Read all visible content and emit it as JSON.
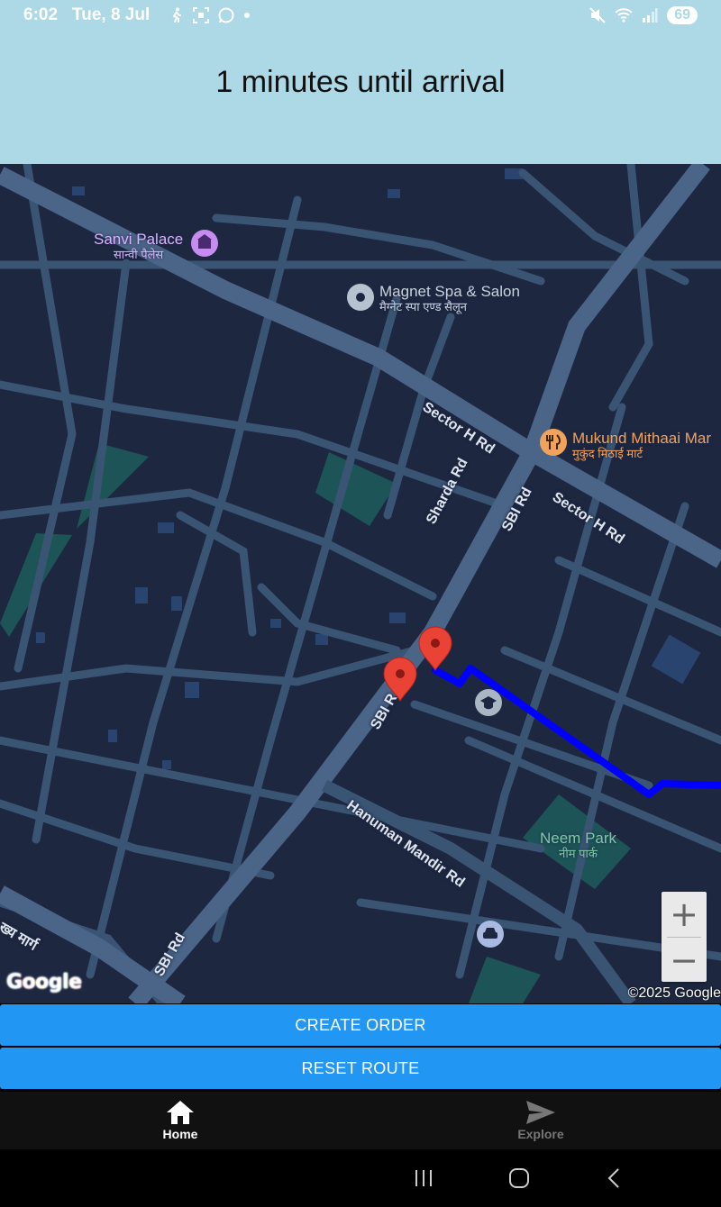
{
  "status_bar": {
    "time": "6:02",
    "date": "Tue, 8 Jul",
    "battery": "69",
    "icons": [
      "walk-icon",
      "scan-icon",
      "whatsapp-icon",
      "dot-icon",
      "mute-icon",
      "wifi-icon",
      "signal-icon"
    ]
  },
  "header": {
    "eta_text": "1 minutes until arrival",
    "background": "#add8e6"
  },
  "map": {
    "theme": "dark",
    "background": "#1d2740",
    "road_color": "#3a5474",
    "route_color": "#0000ff",
    "labels": {
      "sanvi_palace": "Sanvi Palace",
      "sanvi_palace_hi": "सान्वी पैलेस",
      "magnet_spa": "Magnet Spa & Salon",
      "magnet_spa_hi": "मैग्नेट स्पा एण्ड सैलून",
      "sector_h_rd_1": "Sector H Rd",
      "sector_h_rd_2": "Sector H Rd",
      "mukund": "Mukund Mithaai Mar",
      "mukund_hi": "मुकुंद मिठाई मार्ट",
      "sharda_rd": "Sharda Rd",
      "sbi_rd_1": "SBI Rd",
      "sbi_rd_2": "SBI R",
      "sbi_rd_3": "SBI Rd",
      "hanuman_mandir_rd": "Hanuman Mandir Rd",
      "neem_park": "Neem Park",
      "neem_park_hi": "नीम पार्क",
      "left_edge": "ख्य मार्ग"
    },
    "zoom_in": "+",
    "zoom_out": "−",
    "google": "Google",
    "copyright": "©2025 Google"
  },
  "actions": {
    "create_order": "CREATE ORDER",
    "reset_route": "RESET ROUTE",
    "button_color": "#2196f3"
  },
  "bottom_nav": {
    "home": "Home",
    "explore": "Explore"
  }
}
